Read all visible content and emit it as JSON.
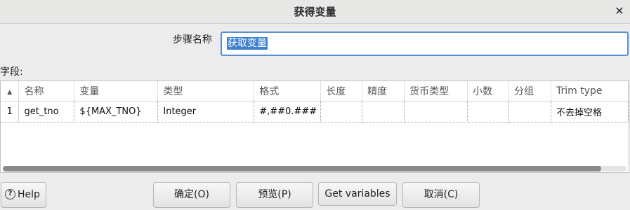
{
  "window": {
    "title": "获得变量",
    "close_glyph": "✕"
  },
  "step": {
    "label": "步骤名称",
    "value": "获取变量"
  },
  "fields": {
    "label": "字段:",
    "sort_glyph": "▲",
    "columns": [
      "名称",
      "变量",
      "类型",
      "格式",
      "长度",
      "精度",
      "货币类型",
      "小数",
      "分组",
      "Trim type"
    ],
    "rows": [
      {
        "index": "1",
        "cells": [
          "get_tno",
          "${MAX_TNO}",
          "Integer",
          "#,##0.###",
          "",
          "",
          "",
          "",
          "",
          "不去掉空格"
        ]
      }
    ],
    "scroll_position": 0.96
  },
  "buttons": {
    "help": "Help",
    "help_icon": "?",
    "ok": "确定(O)",
    "preview": "预览(P)",
    "get_variables": "Get variables",
    "cancel": "取消(C)"
  }
}
